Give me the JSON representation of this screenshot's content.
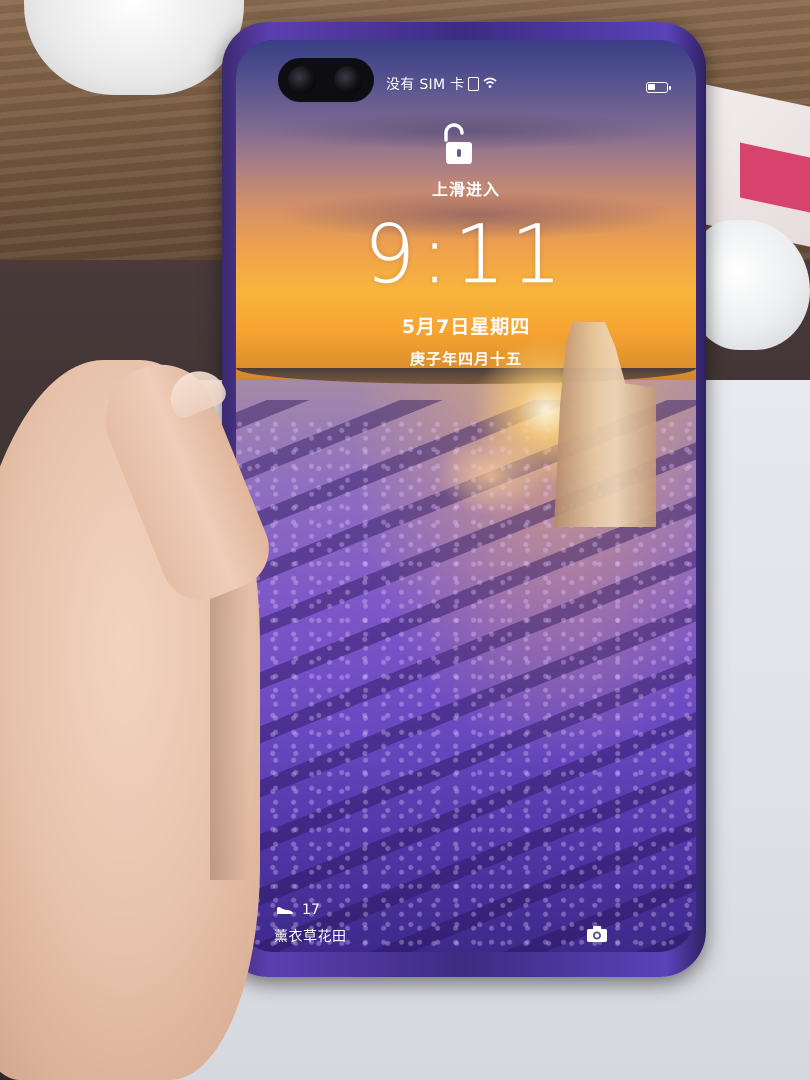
{
  "lockscreen": {
    "status": {
      "sim_text": "没有 SIM 卡",
      "battery_percent": 40
    },
    "unlock_hint": "上滑进入",
    "time": "9:11",
    "date": "5月7日星期四",
    "lunar_date": "庚子年四月十五",
    "steps": "17",
    "wallpaper_caption": "薰衣草花田"
  },
  "colors": {
    "phone_body": "#4a36a0",
    "text": "#ffffff"
  },
  "icons": [
    "lock-open-icon",
    "sim-card-icon",
    "wifi-icon",
    "battery-icon",
    "shoe-icon",
    "camera-icon"
  ]
}
